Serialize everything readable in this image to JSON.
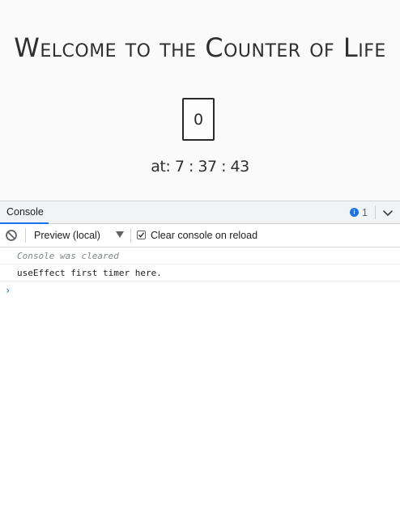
{
  "app": {
    "title": "Welcome to the Counter of Life",
    "counter_value": "0",
    "time_text": "at: 7 : 37 : 43"
  },
  "devtools": {
    "tab_label": "Console",
    "issues_count": "1",
    "info_icon_glyph": "i",
    "context_label": "Preview (local)",
    "clear_on_reload_label": "Clear console on reload",
    "clear_on_reload_checked": true,
    "messages": [
      {
        "text": "Console was cleared",
        "style": "italic"
      },
      {
        "text": "useEffect first timer here.",
        "style": "normal"
      }
    ],
    "prompt_glyph": "›",
    "colors": {
      "accent": "#1a73e8",
      "tab_bar_bg": "#f1f3f4",
      "muted_text": "#80868b"
    },
    "icons": [
      "clear-console-icon",
      "dropdown-arrow-icon",
      "info-icon",
      "chevron-down-icon",
      "checkmark-icon"
    ]
  }
}
